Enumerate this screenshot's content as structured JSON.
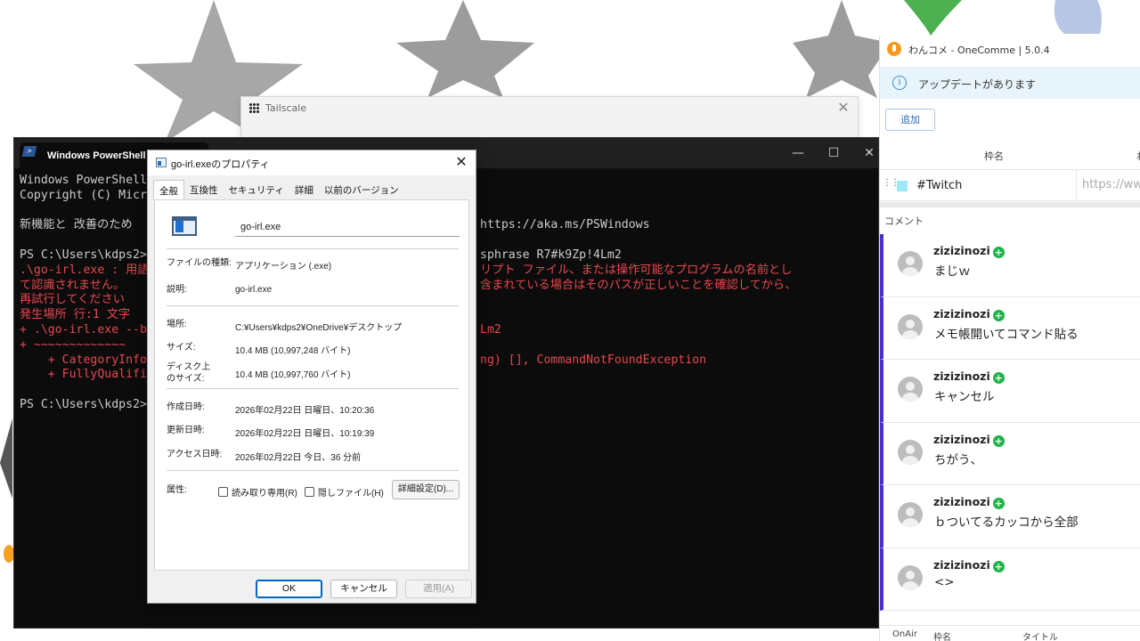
{
  "tailscale": {
    "title": "Tailscale",
    "close": "✕"
  },
  "powershell": {
    "tab_title": "Windows PowerShell",
    "controls": {
      "minimize": "—",
      "maximize": "☐",
      "close": "✕"
    },
    "lines_left": [
      {
        "text": "Windows PowerShell",
        "red": false
      },
      {
        "text": "Copyright (C) Micr",
        "red": false
      },
      {
        "text": "",
        "red": false
      },
      {
        "text": "新機能と 改善のため",
        "red": false
      },
      {
        "text": "",
        "red": false
      },
      {
        "text": "PS C:\\Users\\kdps2>",
        "red": false
      },
      {
        "text": ".\\go-irl.exe : 用語",
        "red": true
      },
      {
        "text": "て認識されません。",
        "red": true
      },
      {
        "text": "再試行してください",
        "red": true
      },
      {
        "text": "発生場所 行:1 文字",
        "red": true
      },
      {
        "text": "+ .\\go-irl.exe --b",
        "red": true
      },
      {
        "text": "+ ~~~~~~~~~~~~~",
        "red": true
      },
      {
        "text": "    + CategoryInfo",
        "red": true
      },
      {
        "text": "    + FullyQualifi",
        "red": true
      },
      {
        "text": "",
        "red": false
      },
      {
        "text": "PS C:\\Users\\kdps2>",
        "red": false
      }
    ],
    "lines_right": [
      {
        "text": "",
        "red": false
      },
      {
        "text": "",
        "red": false
      },
      {
        "text": "",
        "red": false
      },
      {
        "text": "https://aka.ms/PSWindows",
        "red": false
      },
      {
        "text": "",
        "red": false
      },
      {
        "text": "sphrase R7#k9Zp!4Lm2",
        "red": false
      },
      {
        "text": "リプト ファイル、または操作可能なプログラムの名前とし",
        "red": true
      },
      {
        "text": "含まれている場合はそのパスが正しいことを確認してから、",
        "red": true
      },
      {
        "text": "",
        "red": false
      },
      {
        "text": "",
        "red": false
      },
      {
        "text": "Lm2",
        "red": true
      },
      {
        "text": "",
        "red": false
      },
      {
        "text": "ng) [], CommandNotFoundException",
        "red": true
      },
      {
        "text": "",
        "red": false
      },
      {
        "text": "",
        "red": false
      },
      {
        "text": "",
        "red": false
      }
    ]
  },
  "properties": {
    "title": "go-irl.exeのプロパティ",
    "close": "✕",
    "tabs": [
      "全般",
      "互換性",
      "セキュリティ",
      "詳細",
      "以前のバージョン"
    ],
    "filename": "go-irl.exe",
    "fields": {
      "type_label": "ファイルの種類:",
      "type_value": "アプリケーション (.exe)",
      "desc_label": "説明:",
      "desc_value": "go-irl.exe",
      "location_label": "場所:",
      "location_value": "C:¥Users¥kdps2¥OneDrive¥デスクトップ",
      "size_label": "サイズ:",
      "size_value": "10.4 MB (10,997,248 バイト)",
      "disk_label_1": "ディスク上",
      "disk_label_2": "のサイズ:",
      "disk_value": "10.4 MB (10,997,760 バイト)",
      "created_label": "作成日時:",
      "created_value": "2026年02月22日 日曜日、10:20:36",
      "modified_label": "更新日時:",
      "modified_value": "2026年02月22日 日曜日、10:19:39",
      "accessed_label": "アクセス日時:",
      "accessed_value": "2026年02月22日 今日、36 分前",
      "attr_label": "属性:",
      "readonly_label": "読み取り専用(R)",
      "hidden_label": "隠しファイル(H)",
      "advanced_label": "詳細設定(D)..."
    },
    "buttons": {
      "ok": "OK",
      "cancel": "キャンセル",
      "apply": "適用(A)"
    }
  },
  "onecomme": {
    "title": "わんコメ - OneComme | 5.0.4",
    "update_icon": "i",
    "update_text": "アップデートがあります",
    "add_button": "追加",
    "col_frame": "枠名",
    "col_frame_right": "ね",
    "frame": {
      "drag": "⋮⋮",
      "name": "#Twitch",
      "url": "https://www"
    },
    "comment_header": "コメント",
    "comments": [
      {
        "user": "zizizinozi",
        "badge": "+",
        "text": "まじｗ"
      },
      {
        "user": "zizizinozi",
        "badge": "+",
        "text": "メモ帳開いてコマンド貼る"
      },
      {
        "user": "zizizinozi",
        "badge": "+",
        "text": "キャンセル"
      },
      {
        "user": "zizizinozi",
        "badge": "+",
        "text": "ちがう、"
      },
      {
        "user": "zizizinozi",
        "badge": "+",
        "text": "ｂついてるカッコから全部"
      },
      {
        "user": "zizizinozi",
        "badge": "+",
        "text": "<>"
      }
    ],
    "footer": {
      "onair": "OnAir",
      "frame": "枠名",
      "title": "タイトル"
    }
  }
}
